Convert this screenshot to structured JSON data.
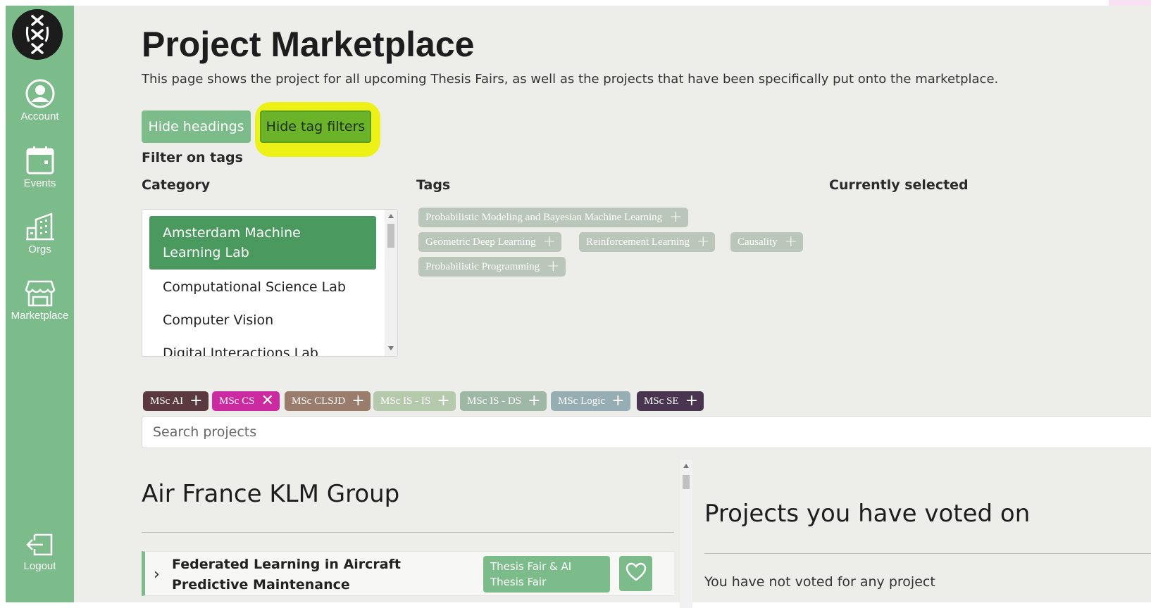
{
  "sidebar": {
    "items": [
      {
        "label": "Account",
        "icon": "account-icon"
      },
      {
        "label": "Events",
        "icon": "calendar-icon"
      },
      {
        "label": "Orgs",
        "icon": "building-icon"
      },
      {
        "label": "Marketplace",
        "icon": "storefront-icon"
      },
      {
        "label": "Logout",
        "icon": "logout-icon"
      }
    ]
  },
  "page": {
    "title": "Project Marketplace",
    "description": "This page shows the project for all upcoming Thesis Fairs, as well as the projects that have been specifically put onto the marketplace."
  },
  "buttons": {
    "hide_headings": "Hide headings",
    "hide_tag_filters": "Hide tag filters"
  },
  "filters": {
    "heading": "Filter on tags",
    "category_label": "Category",
    "tags_label": "Tags",
    "selected_label": "Currently selected",
    "categories": [
      "Amsterdam Machine Learning Lab",
      "Computational Science Lab",
      "Computer Vision",
      "Digital Interactions Lab"
    ],
    "selected_category": "Amsterdam Machine Learning Lab",
    "tags": [
      "Probabilistic Modeling and Bayesian Machine Learning",
      "Geometric Deep Learning",
      "Reinforcement Learning",
      "Causality",
      "Probabilistic Programming"
    ]
  },
  "programmes": [
    {
      "label": "MSc AI",
      "color": "#5a3a3e",
      "action": "+"
    },
    {
      "label": "MSc CS",
      "color": "#cc2aa0",
      "action": "✕"
    },
    {
      "label": "MSc CLSJD",
      "color": "#9a7c6c",
      "action": "+"
    },
    {
      "label": "MSc IS - IS",
      "color": "#b5c9ad",
      "action": "+"
    },
    {
      "label": "MSc IS - DS",
      "color": "#9fb8a6",
      "action": "+"
    },
    {
      "label": "MSc Logic",
      "color": "#96aeb3",
      "action": "+"
    },
    {
      "label": "MSc SE",
      "color": "#4a3550",
      "action": "+"
    }
  ],
  "search": {
    "placeholder": "Search projects"
  },
  "groups": [
    {
      "name": "Air France KLM Group",
      "projects": [
        {
          "title": "Federated Learning in Aircraft Predictive Maintenance",
          "event": "Thesis Fair & AI Thesis Fair"
        }
      ]
    }
  ],
  "voted": {
    "title": "Projects you have voted on",
    "empty": "You have not voted for any project"
  },
  "colors": {
    "sidebar": "#7cbc8a",
    "selected_category": "#4a9a5f",
    "highlight": "#eef116",
    "active_button": "#6bb42a",
    "background": "#edeee9"
  }
}
